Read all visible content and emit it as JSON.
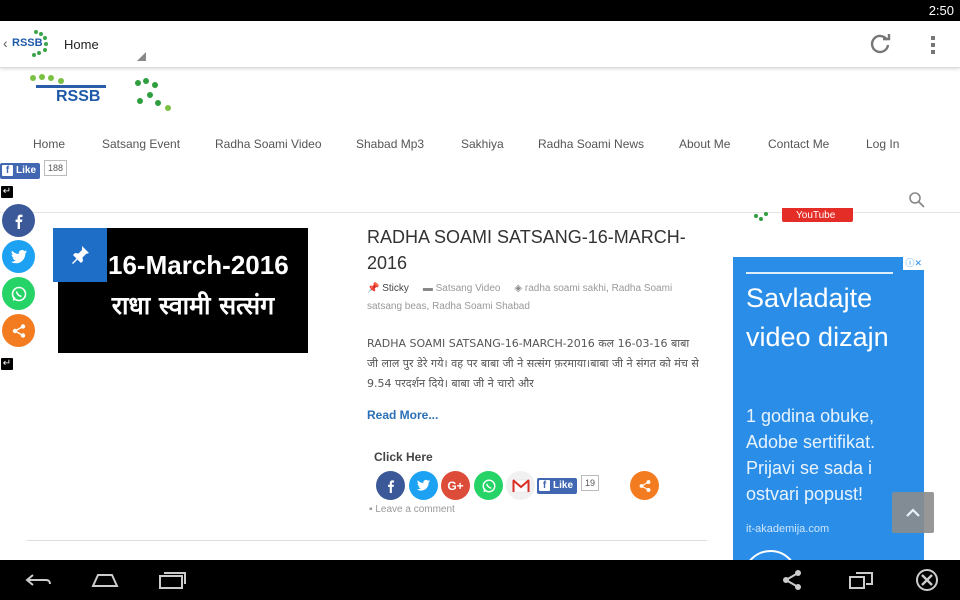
{
  "status_bar": {
    "time": "2:50"
  },
  "app_bar": {
    "title": "Home",
    "logo_text": "RSSB"
  },
  "site": {
    "logo_text": "RSSB"
  },
  "nav": {
    "items": [
      "Home",
      "Satsang Event",
      "Radha Soami Video",
      "Shabad Mp3",
      "Sakhiya",
      "Radha Soami News",
      "About Me",
      "Contact Me",
      "Log In"
    ]
  },
  "fb_like_top": {
    "label": "Like",
    "count": "188"
  },
  "widget": {
    "youtube_label": "YouTube"
  },
  "post": {
    "thumb_line1": "16-March-2016",
    "thumb_line2": "राधा स्वामी सत्संग",
    "title": "RADHA SOAMI SATSANG-16-MARCH-2016",
    "sticky": "Sticky",
    "category": "Satsang Video",
    "tags": [
      "radha soami sakhi",
      "Radha Soami satsang beas",
      "Radha Soami Shabad"
    ],
    "excerpt": "RADHA SOAMI SATSANG-16-MARCH-2016 कल 16-03-16 बाबा जी लाल पुर डेरे गये। वह पर बाबा जी ने सत्संग फ़रमाया।बाबा जी ने संगत को मंच से 9.54 परदर्शन दिये। बाबा जी ने चारो और",
    "read_more": "Read More...",
    "click_here": "Click Here",
    "fb_like_label": "Like",
    "fb_like_count": "19",
    "leave_comment": "Leave a comment"
  },
  "ad": {
    "headline": "Savladajte video dizajn",
    "body": "1 godina obuke, Adobe sertifikat. Prijavi se sada i ostvari popust!",
    "url": "it-akademija.com"
  },
  "colors": {
    "facebook": "#3b5998",
    "twitter": "#1da1f2",
    "whatsapp": "#25d366",
    "share": "#f47c20",
    "google_plus": "#dd4b39",
    "ad_bg": "#2a8ee8",
    "link": "#2b6fb7"
  }
}
